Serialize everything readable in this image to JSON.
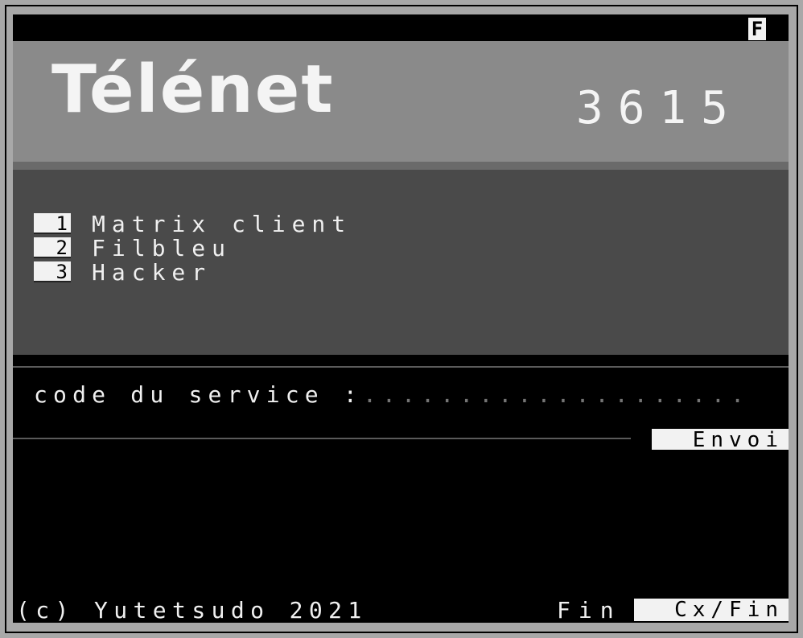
{
  "status": {
    "indicator": "F"
  },
  "header": {
    "brand": "Télénet",
    "service_number": "3615"
  },
  "menu": {
    "items": [
      {
        "key": "1",
        "label": "Matrix client"
      },
      {
        "key": "2",
        "label": "Filbleu"
      },
      {
        "key": "3",
        "label": "Hacker"
      }
    ]
  },
  "input": {
    "label": "code du service :",
    "value": "",
    "placeholder": "....................",
    "send_label": "Envoi"
  },
  "footer": {
    "copyright": "(c) Yutetsudo 2021",
    "fin_label": "Fin",
    "cxfin_label": "Cx/Fin"
  },
  "colors": {
    "banner": "#8a8a8a",
    "panel": "#4a4a4a",
    "screen": "#000000",
    "highlight": "#f2f2f2"
  }
}
